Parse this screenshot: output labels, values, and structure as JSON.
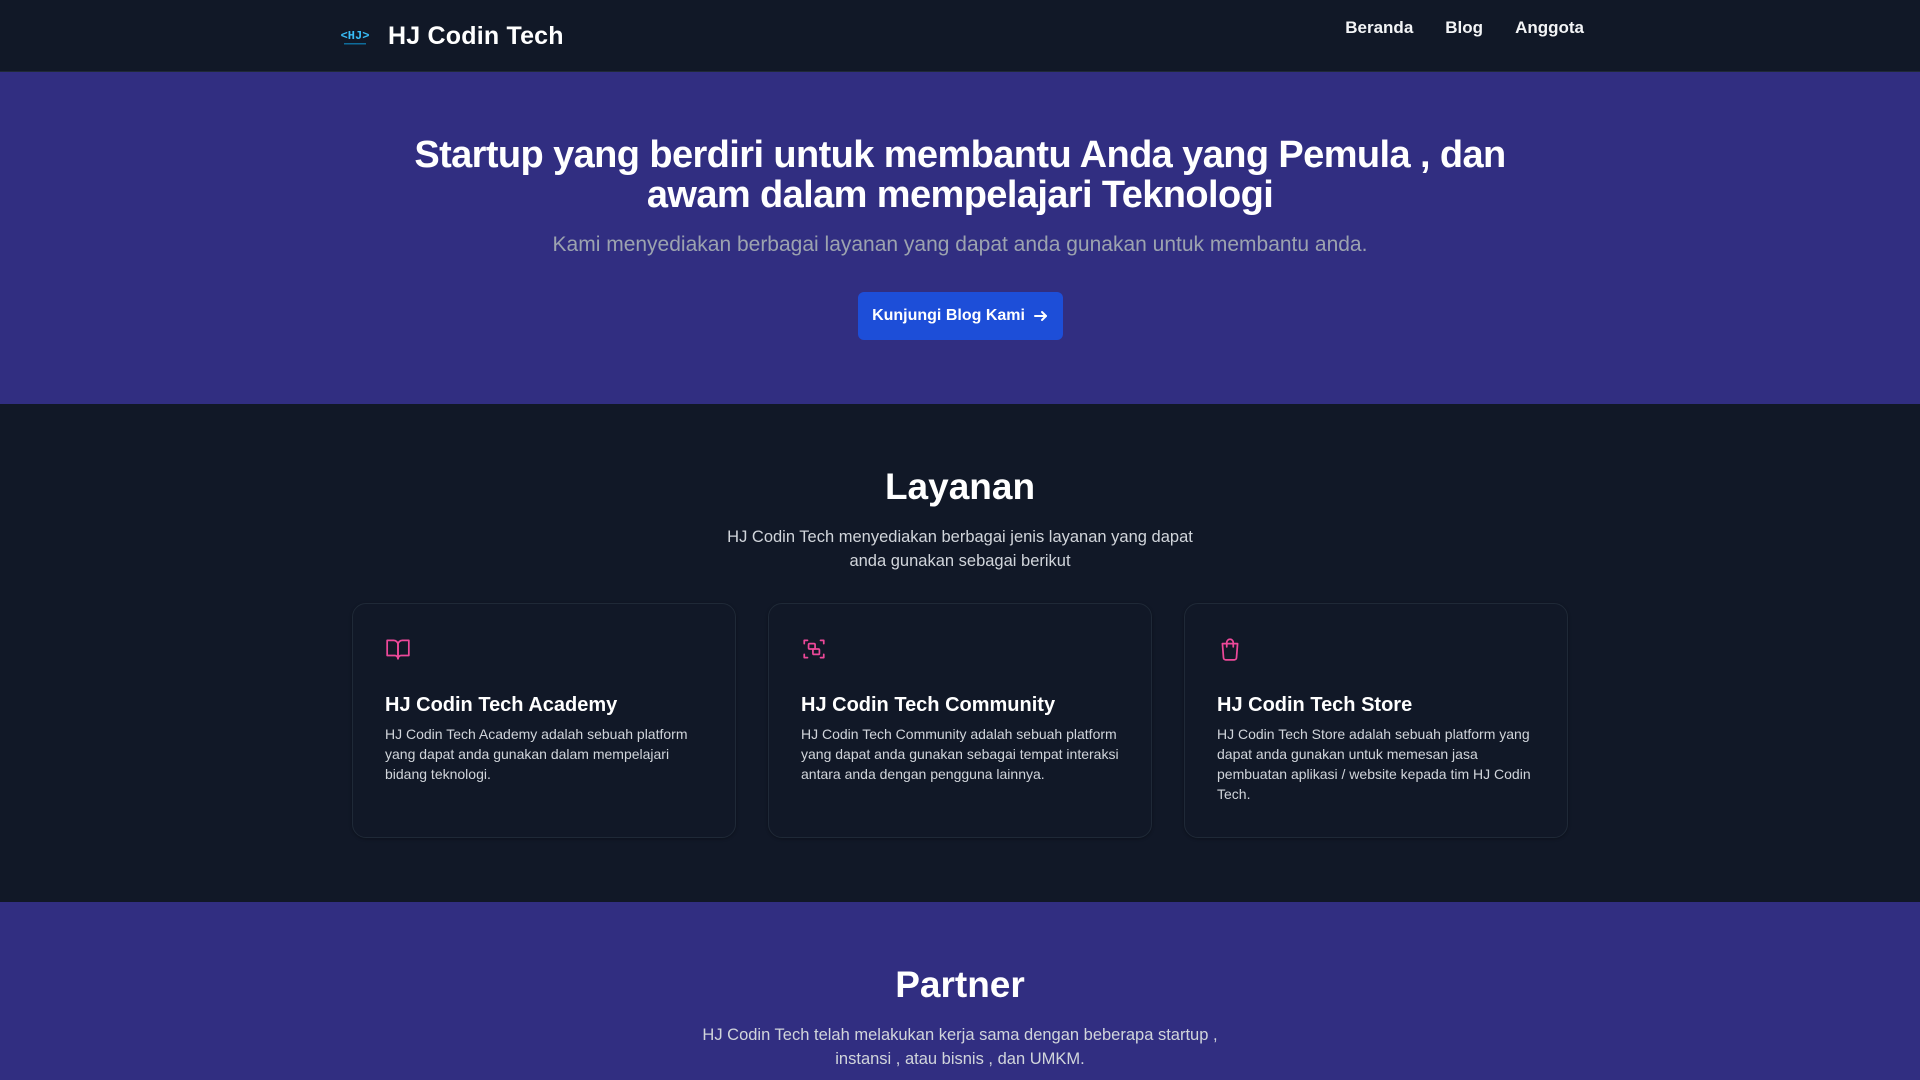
{
  "nav": {
    "brand": "HJ Codin Tech",
    "logo_text": "<HJ>",
    "links": [
      "Beranda",
      "Blog",
      "Anggota"
    ]
  },
  "hero": {
    "title": "Startup yang berdiri untuk membantu Anda yang Pemula , dan awam dalam mempelajari Teknologi",
    "subtitle": "Kami menyediakan berbagai layanan yang dapat anda gunakan untuk membantu anda.",
    "cta_label": "Kunjungi Blog Kami"
  },
  "services": {
    "title": "Layanan",
    "subtitle": "HJ Codin Tech menyediakan berbagai jenis layanan yang dapat anda gunakan sebagai berikut",
    "cards": [
      {
        "icon": "book-open-icon",
        "title": "HJ Codin Tech Academy",
        "desc": "HJ Codin Tech Academy adalah sebuah platform yang dapat anda gunakan dalam mempelajari bidang teknologi."
      },
      {
        "icon": "community-icon",
        "title": "HJ Codin Tech Community",
        "desc": "HJ Codin Tech Community adalah sebuah platform yang dapat anda gunakan sebagai tempat interaksi antara anda dengan pengguna lainnya."
      },
      {
        "icon": "shopping-bag-icon",
        "title": "HJ Codin Tech Store",
        "desc": "HJ Codin Tech Store adalah sebuah platform yang dapat anda gunakan untuk memesan jasa pembuatan aplikasi / website kepada tim HJ Codin Tech."
      }
    ]
  },
  "partner": {
    "title": "Partner",
    "subtitle": "HJ Codin Tech telah melakukan kerja sama dengan beberapa startup , instansi , atau bisnis , dan UMKM."
  },
  "colors": {
    "nav_bg": "#111827",
    "hero_bg": "#312e81",
    "accent_button": "#1d4ed8",
    "icon_pink": "#ec4899"
  }
}
